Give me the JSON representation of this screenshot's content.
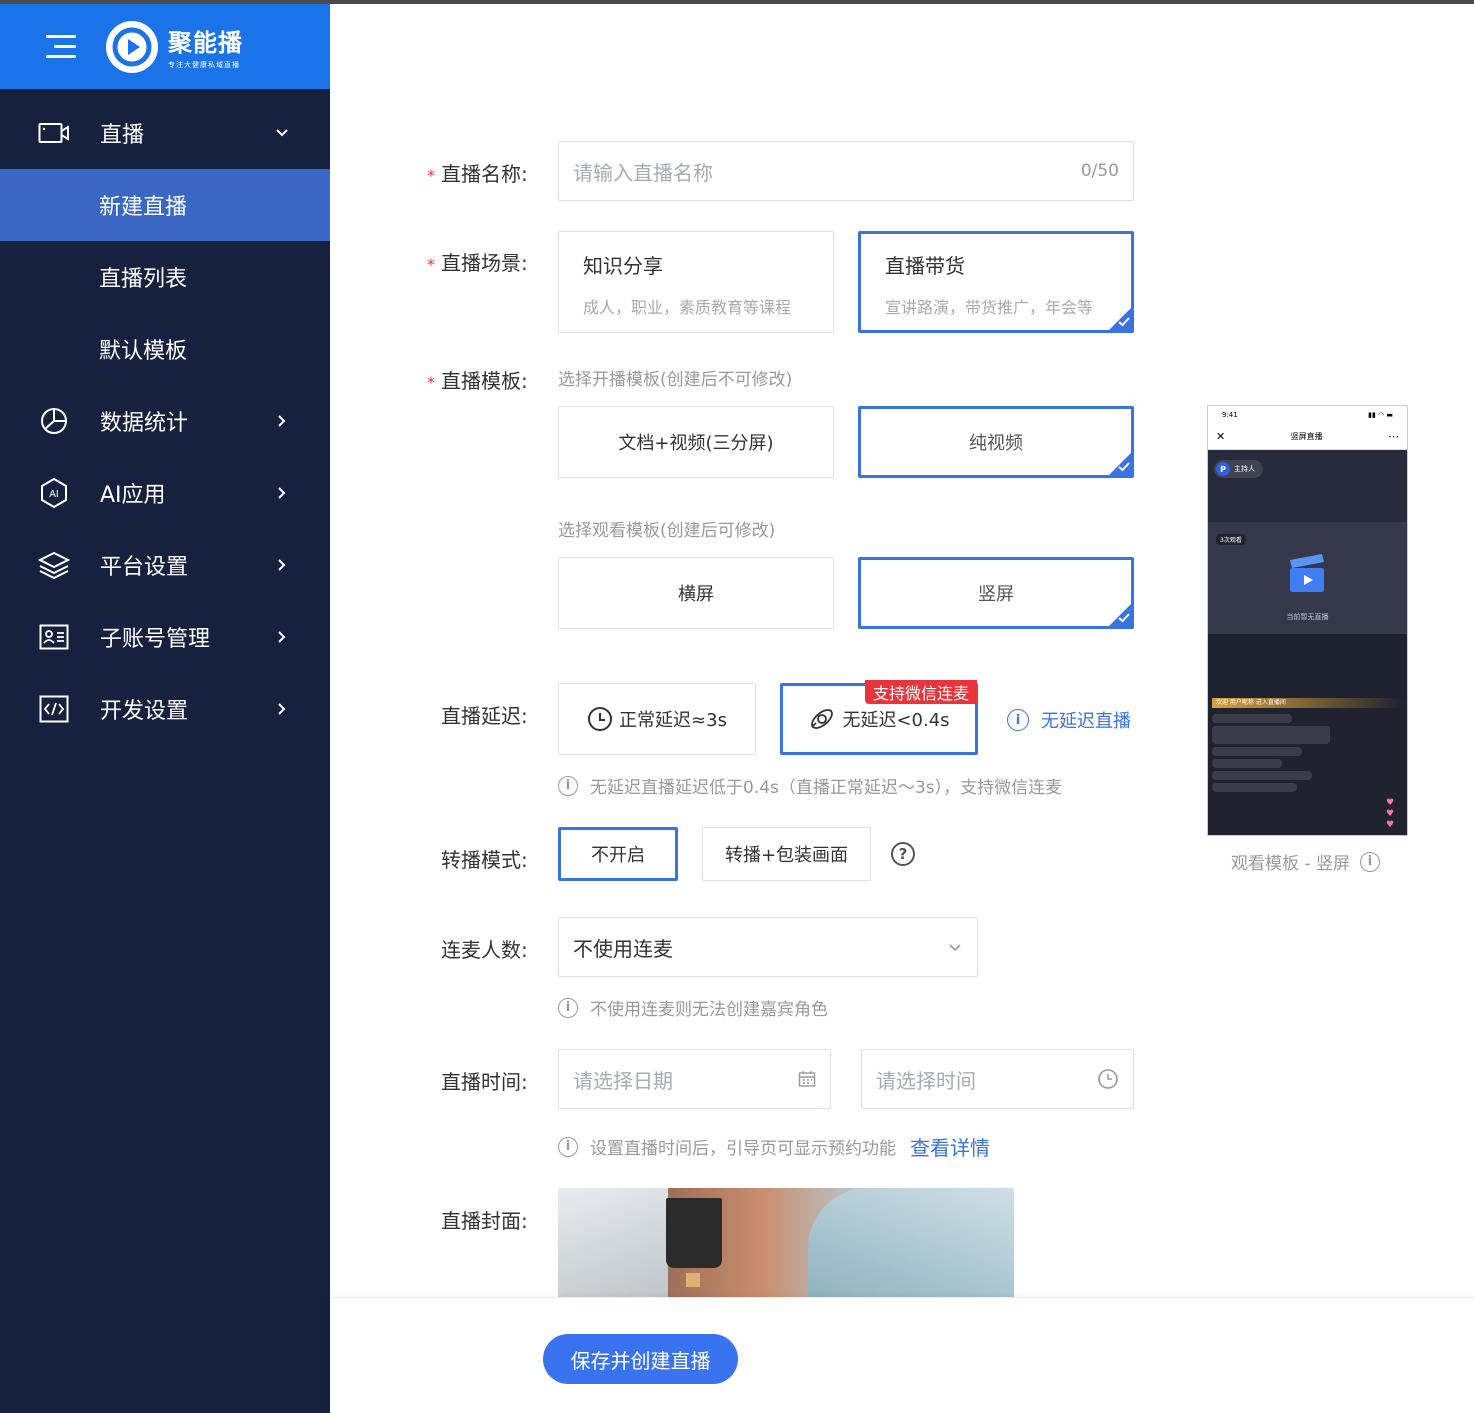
{
  "brand": {
    "name": "聚能播",
    "slogan": "专注大健康私域直播"
  },
  "sidebar": {
    "items": [
      {
        "label": "直播",
        "icon": "video-camera-icon"
      },
      {
        "label": "数据统计",
        "icon": "pie-chart-icon"
      },
      {
        "label": "AI应用",
        "icon": "ai-hexagon-icon"
      },
      {
        "label": "平台设置",
        "icon": "layers-icon"
      },
      {
        "label": "子账号管理",
        "icon": "id-card-icon"
      },
      {
        "label": "开发设置",
        "icon": "code-icon"
      }
    ],
    "sub_items": [
      {
        "label": "新建直播",
        "active": true
      },
      {
        "label": "直播列表"
      },
      {
        "label": "默认模板"
      }
    ]
  },
  "form": {
    "name": {
      "label": "直播名称:",
      "placeholder": "请输入直播名称",
      "counter": "0/50"
    },
    "scene": {
      "label": "直播场景:",
      "options": [
        {
          "title": "知识分享",
          "desc": "成人，职业，素质教育等课程"
        },
        {
          "title": "直播带货",
          "desc": "宣讲路演，带货推广，年会等"
        }
      ]
    },
    "template": {
      "label": "直播模板:",
      "open_hint": "选择开播模板(创建后不可修改)",
      "open_options": [
        "文档+视频(三分屏)",
        "纯视频"
      ],
      "watch_hint": "选择观看模板(创建后可修改)",
      "watch_options": [
        "横屏",
        "竖屏"
      ]
    },
    "delay": {
      "label": "直播延迟:",
      "options": [
        "正常延迟≈3s",
        "无延迟<0.4s"
      ],
      "badge": "支持微信连麦",
      "link": "无延迟直播",
      "hint": "无延迟直播延迟低于0.4s（直播正常延迟～3s），支持微信连麦"
    },
    "relay": {
      "label": "转播模式:",
      "options": [
        "不开启",
        "转播+包装画面"
      ]
    },
    "mic": {
      "label": "连麦人数:",
      "value": "不使用连麦",
      "hint": "不使用连麦则无法创建嘉宾角色"
    },
    "time": {
      "label": "直播时间:",
      "date_placeholder": "请选择日期",
      "time_placeholder": "请选择时间",
      "hint": "设置直播时间后，引导页可显示预约功能",
      "link": "查看详情"
    },
    "cover": {
      "label": "直播封面:"
    }
  },
  "preview": {
    "caption": "观看模板 - 竖屏",
    "phone_time": "9:41",
    "phone_title": "竖屏直播",
    "host": "主持人",
    "views": "3次观看",
    "empty_text": "当前暂无直播",
    "welcome": "欢迎 用户昵称 进入直播间"
  },
  "footer": {
    "submit": "保存并创建直播"
  },
  "colors": {
    "primary": "#3a73e0",
    "sidebar": "#16213f",
    "brand": "#1a73e8",
    "badge": "#e8343a"
  }
}
